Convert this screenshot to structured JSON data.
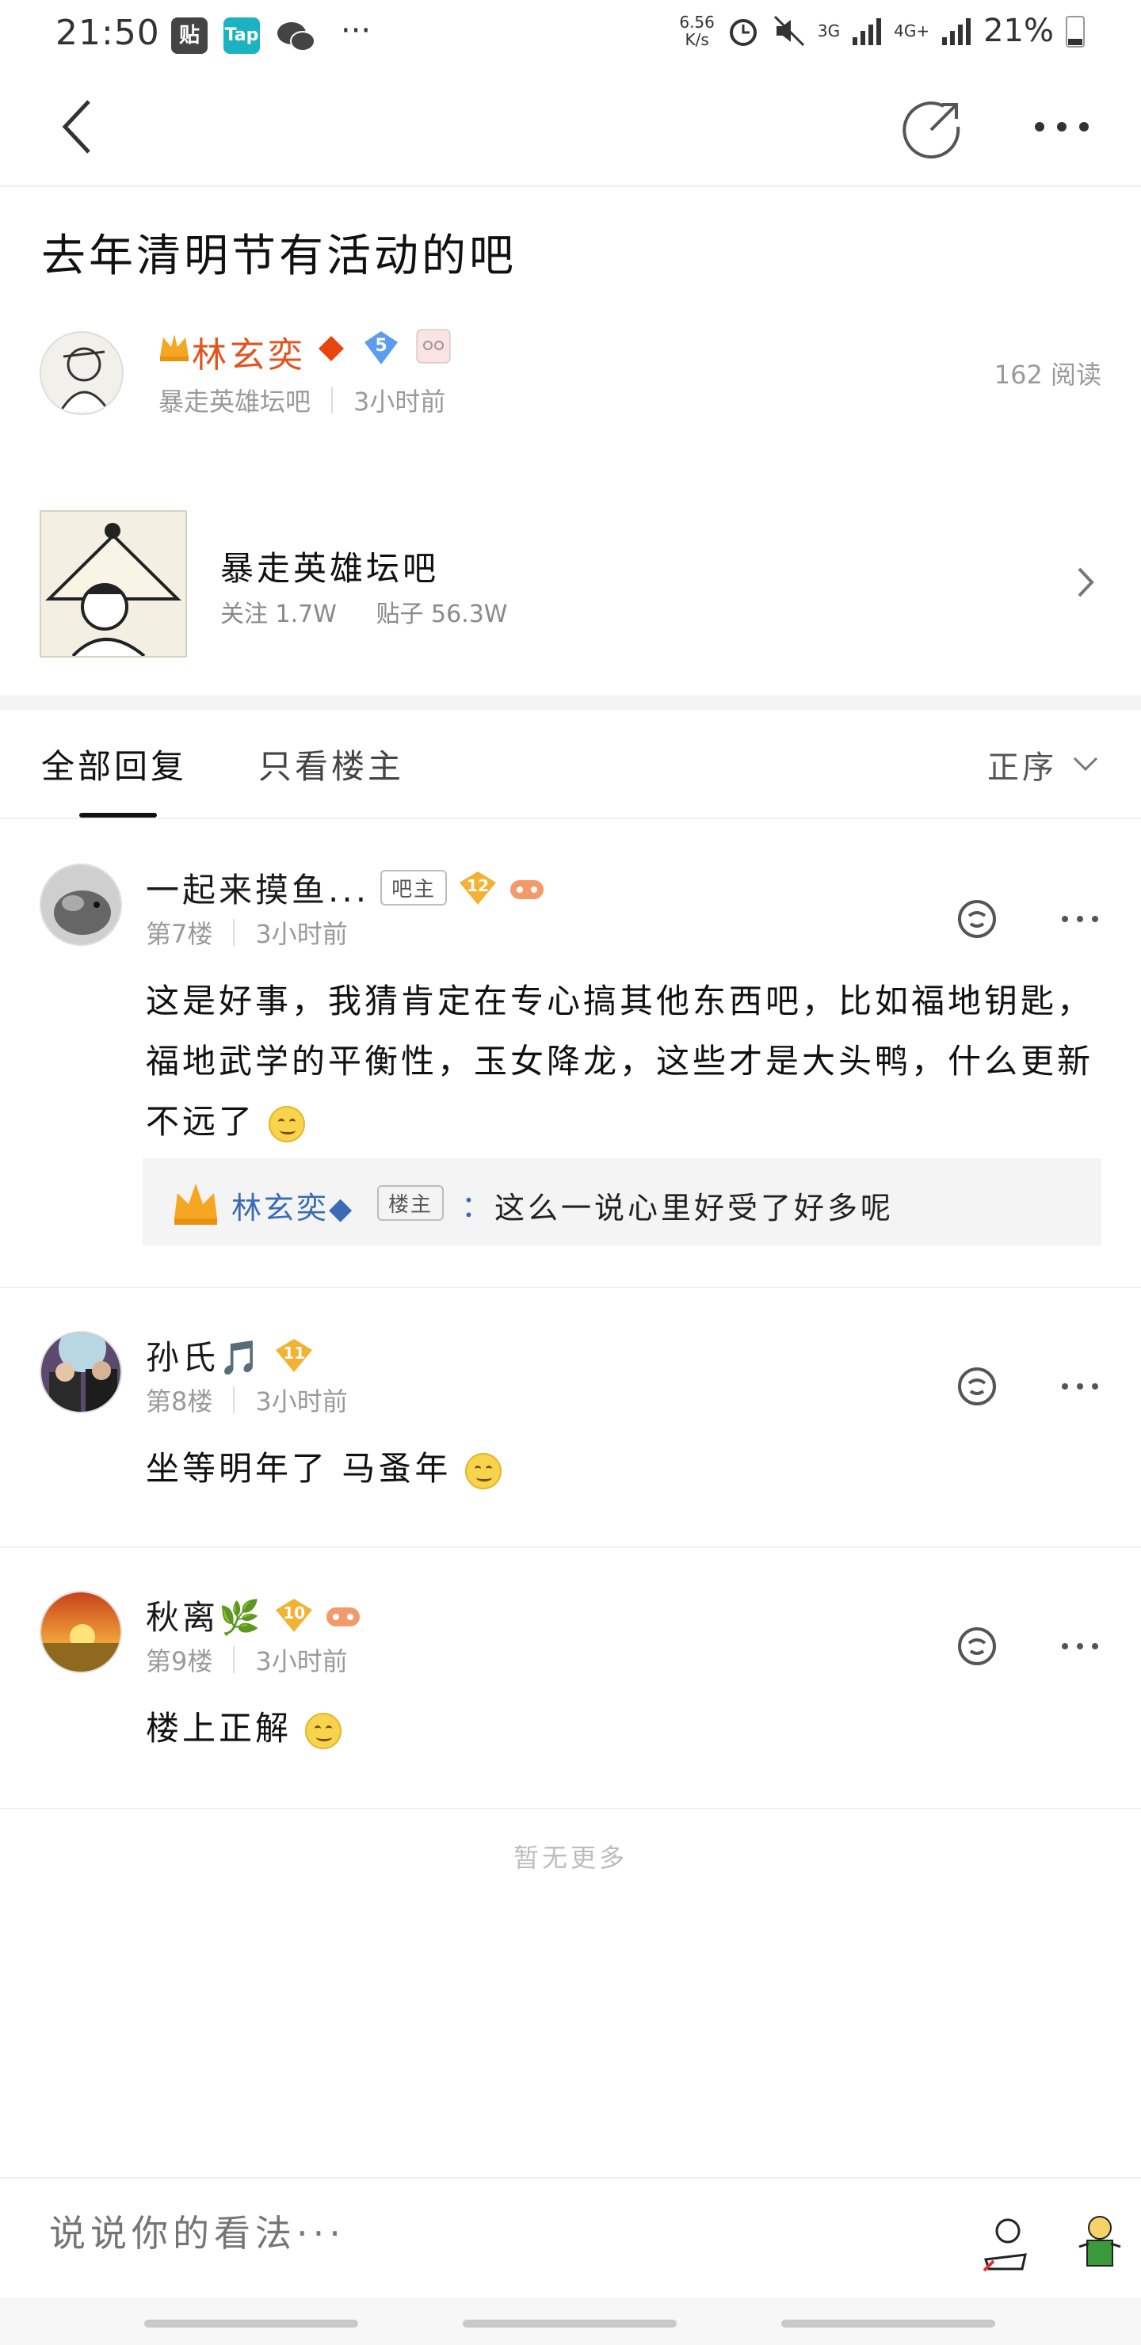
{
  "status_bar": {
    "time": "21:50",
    "apps": [
      {
        "name": "tieba-app-icon",
        "label": "贴",
        "color": "#444444"
      },
      {
        "name": "taptap-app-icon",
        "label": "Tap",
        "color": "#1bb3c1"
      },
      {
        "name": "wechat-app-icon",
        "label": "",
        "color": "#444444"
      }
    ],
    "more": "···",
    "speed_value": "6.56",
    "speed_unit": "K/s",
    "network_3g": "3G",
    "network_4g": "4G+",
    "battery": "21%"
  },
  "post": {
    "title": "去年清明节有活动的吧",
    "author_name": "林玄奕",
    "author_level": "5",
    "forum": "暴走英雄坛吧",
    "time": "3小时前",
    "read_count": "162 阅读"
  },
  "forum_card": {
    "name": "暴走英雄坛吧",
    "follow": "关注 1.7W",
    "posts": "贴子 56.3W"
  },
  "tabs": {
    "all": "全部回复",
    "owner_only": "只看楼主",
    "sort": "正序"
  },
  "replies": [
    {
      "name": "一起来摸鱼...",
      "badge": "吧主",
      "level": "12",
      "floor": "第7楼",
      "time": "3小时前",
      "text": "这是好事，我猜肯定在专心搞其他东西吧，比如福地钥匙，福地武学的平衡性，玉女降龙，这些才是大头鸭，什么更新不远了",
      "sub_reply": {
        "name": "林玄奕◆",
        "badge": "楼主",
        "colon": "：",
        "text": "这么一说心里好受了好多呢"
      }
    },
    {
      "name": "孙氏🎵",
      "level": "11",
      "floor": "第8楼",
      "time": "3小时前",
      "text": "坐等明年了 马蚤年"
    },
    {
      "name": "秋离🌿",
      "level": "10",
      "floor": "第9楼",
      "time": "3小时前",
      "text": "楼上正解"
    }
  ],
  "footer": {
    "no_more": "暂无更多",
    "input_placeholder": "说说你的看法···"
  },
  "colors": {
    "author_orange": "#e0541e",
    "link_blue": "#3b6bb5",
    "level_gold": "#f2b233",
    "level_blue": "#5b9cf0"
  }
}
